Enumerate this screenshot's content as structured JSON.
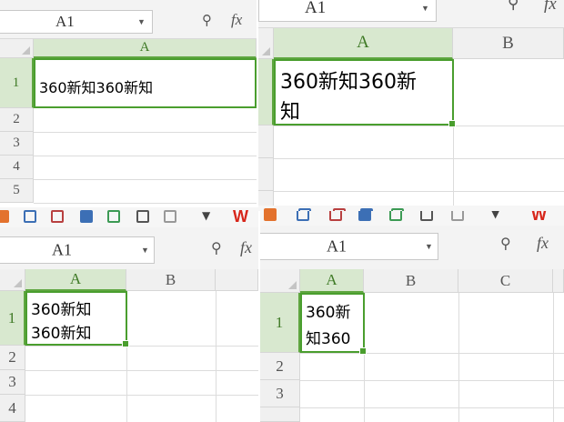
{
  "formula_bar": {
    "name_box": "A1",
    "dropdown_icon": "dropdown-caret-icon",
    "zoom_icon": "zoom-icon",
    "fx_label": "fx"
  },
  "columns": {
    "a": "A",
    "b": "B",
    "c": "C"
  },
  "rows": {
    "r1": "1",
    "r2": "2",
    "r3": "3",
    "r4": "4",
    "r5": "5"
  },
  "cell_a1": {
    "single_line": "360新知360新知",
    "wrapped_p2": [
      "360新知360新",
      "知"
    ],
    "wrapped_p3": [
      "360新知",
      "360新知"
    ],
    "wrapped_p4": [
      "360新",
      "知360"
    ]
  },
  "colors": {
    "accent": "#4a9e2e",
    "header_selected": "#d8e8cf",
    "wps_red": "#d7261b"
  }
}
